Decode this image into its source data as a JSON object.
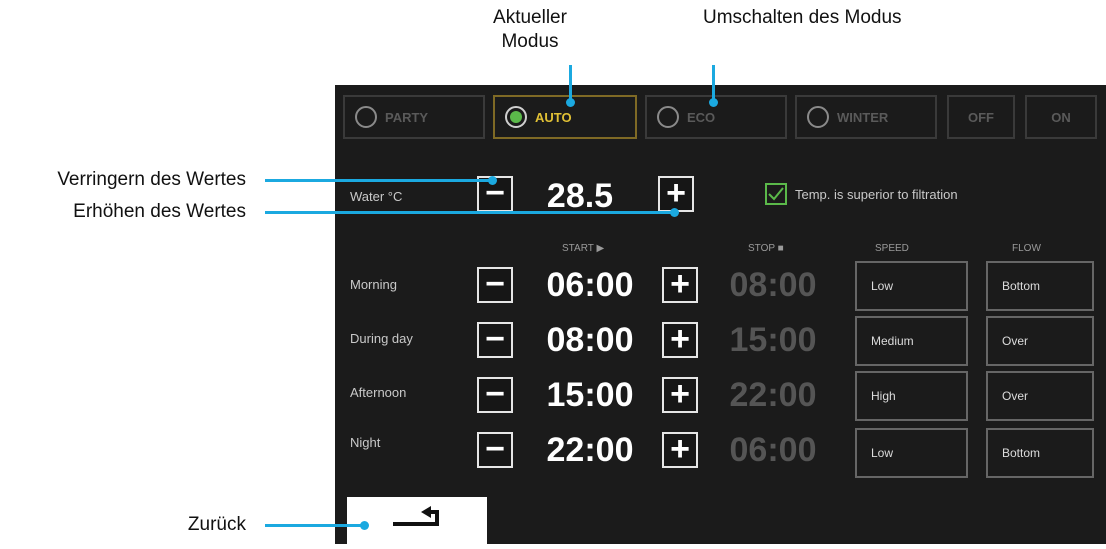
{
  "annotations": {
    "current_mode_line1": "Aktueller",
    "current_mode_line2": "Modus",
    "switch_mode": "Umschalten des Modus",
    "decrease_value": "Verringern des Wertes",
    "increase_value": "Erhöhen des Wertes",
    "back": "Zurück"
  },
  "modes": {
    "party": "PARTY",
    "auto": "AUTO",
    "eco": "ECO",
    "winter": "WINTER",
    "off": "OFF",
    "on": "ON",
    "active": "AUTO"
  },
  "water": {
    "label": "Water °C",
    "value": "28.5",
    "minus": "−",
    "plus": "+",
    "checkbox_label": "Temp. is superior to filtration",
    "checkbox_checked": true
  },
  "table": {
    "headers": {
      "start": "START ▶",
      "stop": "STOP ■",
      "speed": "SPEED",
      "flow": "FLOW"
    },
    "rows": [
      {
        "label": "Morning",
        "start": "06:00",
        "stop": "08:00",
        "speed": "Low",
        "flow": "Bottom"
      },
      {
        "label": "During day",
        "start": "08:00",
        "stop": "15:00",
        "speed": "Medium",
        "flow": "Over"
      },
      {
        "label": "Afternoon",
        "start": "15:00",
        "stop": "22:00",
        "speed": "High",
        "flow": "Over"
      },
      {
        "label": "Night",
        "start": "22:00",
        "stop": "06:00",
        "speed": "Low",
        "flow": "Bottom"
      }
    ],
    "minus": "−",
    "plus": "+"
  },
  "icons": {
    "back": "back-arrow-icon",
    "check": "check-icon"
  },
  "colors": {
    "accent_line": "#1ba9e0",
    "active_mode": "#e0c035",
    "radio_on": "#5bb94a",
    "screen_bg": "#1b1b1b"
  }
}
